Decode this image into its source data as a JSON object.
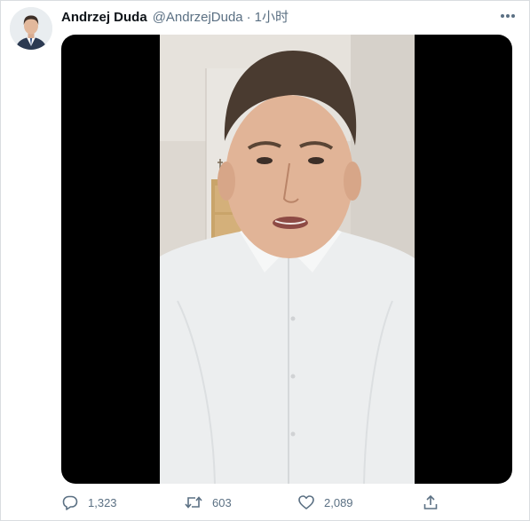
{
  "tweet": {
    "author": {
      "display_name": "Andrzej Duda",
      "handle": "@AndrzejDuda",
      "avatar_icon": "profile-photo-avatar"
    },
    "separator": "·",
    "timestamp": "1小时",
    "more_icon": "more-horizontal-icon",
    "media": {
      "type": "video",
      "letterbox_color": "#000000"
    },
    "actions": {
      "reply": {
        "icon": "reply-icon",
        "count": "1,323"
      },
      "retweet": {
        "icon": "retweet-icon",
        "count": "603"
      },
      "like": {
        "icon": "heart-icon",
        "count": "2,089"
      },
      "share": {
        "icon": "share-icon"
      }
    }
  },
  "colors": {
    "primary_text": "#0f1419",
    "secondary_text": "#5b7083",
    "border": "#d9dde0",
    "background": "#ffffff"
  }
}
